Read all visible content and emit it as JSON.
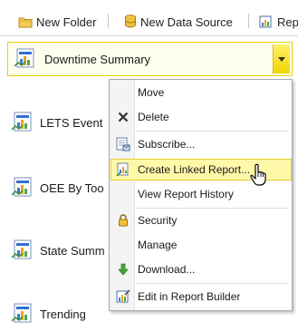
{
  "toolbar": {
    "new_folder_label": "New Folder",
    "new_data_source_label": "New Data Source",
    "report_builder_label": "Rep"
  },
  "reports": [
    {
      "label": "Downtime Summary",
      "icon": "report-icon"
    },
    {
      "label": "LETS Event",
      "icon": "report-icon"
    },
    {
      "label": "OEE By Too",
      "icon": "report-icon"
    },
    {
      "label": "State Summ",
      "icon": "report-icon"
    },
    {
      "label": "Trending",
      "icon": "report-icon"
    }
  ],
  "menu": {
    "items": [
      {
        "label": "Move",
        "icon": ""
      },
      {
        "label": "Delete",
        "icon": "delete-x-icon"
      },
      {
        "label": "Subscribe...",
        "icon": "subscribe-icon"
      },
      {
        "label": "Create Linked Report...",
        "icon": "linked-report-icon",
        "highlighted": true
      },
      {
        "label": "View Report History",
        "icon": ""
      },
      {
        "label": "Security",
        "icon": "lock-icon"
      },
      {
        "label": "Manage",
        "icon": ""
      },
      {
        "label": "Download...",
        "icon": "download-arrow-icon"
      },
      {
        "label": "Edit in Report Builder",
        "icon": "report-builder-icon"
      }
    ]
  },
  "colors": {
    "selection_border": "#e8d000",
    "highlight_background": "#fff8a8",
    "dropdown_button": "#f2d200"
  }
}
